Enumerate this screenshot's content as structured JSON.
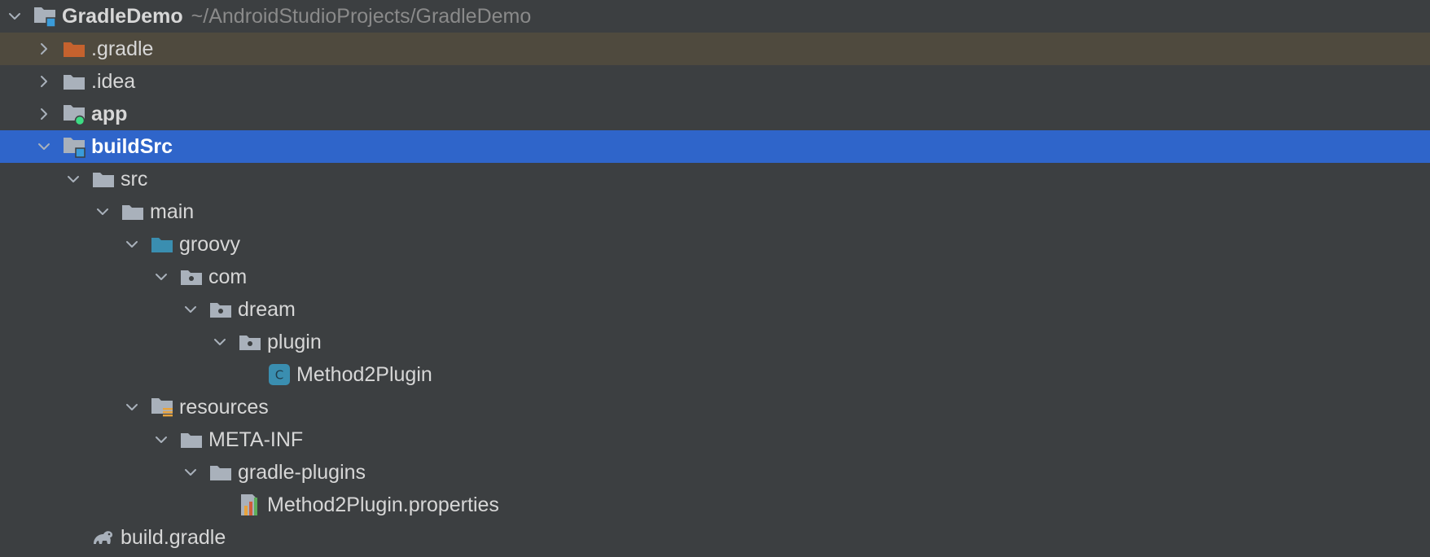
{
  "project": {
    "name": "GradleDemo",
    "path": "~/AndroidStudioProjects/GradleDemo"
  },
  "tree": [
    {
      "label": "GradleDemo",
      "depth": 0,
      "expanded": true,
      "icon": "module-folder-icon",
      "bold": true
    },
    {
      "label": ".gradle",
      "depth": 1,
      "expanded": false,
      "icon": "excluded-folder-icon",
      "bold": false
    },
    {
      "label": ".idea",
      "depth": 1,
      "expanded": false,
      "icon": "folder-icon",
      "bold": false
    },
    {
      "label": "app",
      "depth": 1,
      "expanded": false,
      "icon": "android-module-folder-icon",
      "bold": true
    },
    {
      "label": "buildSrc",
      "depth": 1,
      "expanded": true,
      "icon": "module-folder-icon",
      "bold": true,
      "selected": true
    },
    {
      "label": "src",
      "depth": 2,
      "expanded": true,
      "icon": "folder-icon",
      "bold": false
    },
    {
      "label": "main",
      "depth": 3,
      "expanded": true,
      "icon": "folder-icon",
      "bold": false
    },
    {
      "label": "groovy",
      "depth": 4,
      "expanded": true,
      "icon": "source-root-folder-icon",
      "bold": false
    },
    {
      "label": "com",
      "depth": 5,
      "expanded": true,
      "icon": "package-folder-icon",
      "bold": false
    },
    {
      "label": "dream",
      "depth": 6,
      "expanded": true,
      "icon": "package-folder-icon",
      "bold": false
    },
    {
      "label": "plugin",
      "depth": 7,
      "expanded": true,
      "icon": "package-folder-icon",
      "bold": false
    },
    {
      "label": "Method2Plugin",
      "depth": 8,
      "icon": "groovy-class-icon",
      "bold": false
    },
    {
      "label": "resources",
      "depth": 4,
      "expanded": true,
      "icon": "resources-folder-icon",
      "bold": false
    },
    {
      "label": "META-INF",
      "depth": 5,
      "expanded": true,
      "icon": "folder-icon",
      "bold": false
    },
    {
      "label": "gradle-plugins",
      "depth": 6,
      "expanded": true,
      "icon": "folder-icon",
      "bold": false
    },
    {
      "label": "Method2Plugin.properties",
      "depth": 7,
      "icon": "properties-file-icon",
      "bold": false
    },
    {
      "label": "build.gradle",
      "depth": 2,
      "icon": "gradle-elephant-icon",
      "bold": false
    }
  ],
  "colors": {
    "background": "#3C3F41",
    "selection": "#2F65CA",
    "excluded_row": "#4F4A3E",
    "text": "#D7D7D7",
    "muted_text": "#8A8A8A",
    "folder": "#A9B1BB",
    "excluded_folder": "#C5622E",
    "source_root": "#3A8EB0",
    "module_mark": "#3A9BD9",
    "android_mark": "#3DDC84"
  }
}
